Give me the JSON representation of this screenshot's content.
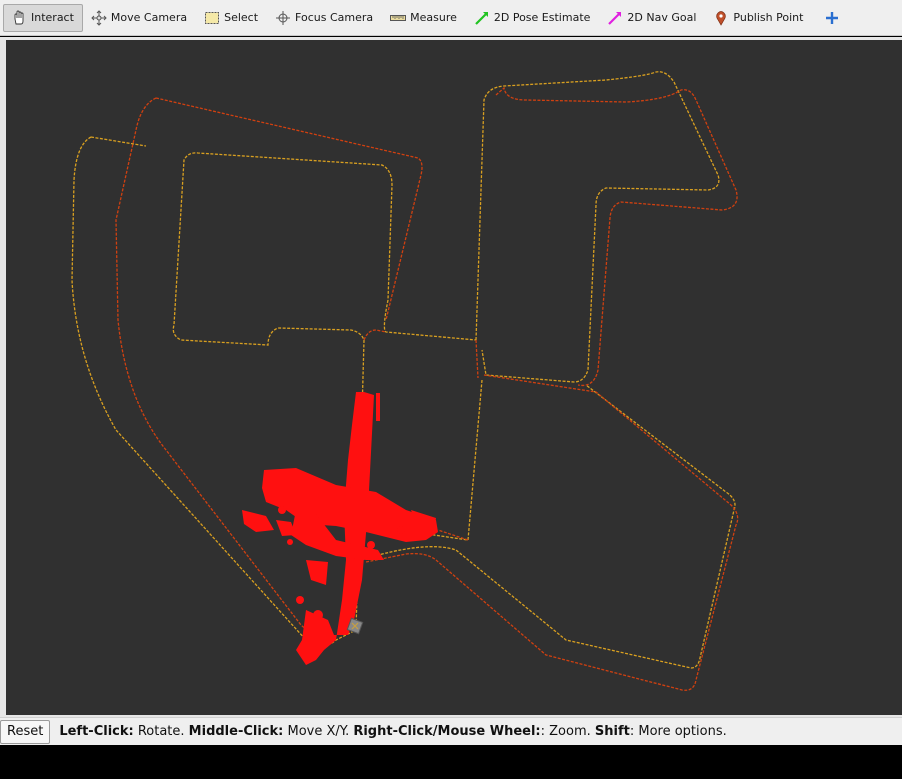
{
  "toolbar": {
    "tools": [
      {
        "label": "Interact",
        "icon": "hand-pointer-icon",
        "active": true
      },
      {
        "label": "Move Camera",
        "icon": "move-arrows-icon"
      },
      {
        "label": "Select",
        "icon": "select-box-icon"
      },
      {
        "label": "Focus Camera",
        "icon": "focus-target-icon"
      },
      {
        "label": "Measure",
        "icon": "ruler-icon"
      },
      {
        "label": "2D Pose Estimate",
        "icon": "green-arrow-icon",
        "color": "#22c322"
      },
      {
        "label": "2D Nav Goal",
        "icon": "magenta-arrow-icon",
        "color": "#e020e0"
      },
      {
        "label": "Publish Point",
        "icon": "map-pin-icon",
        "color": "#c0502a"
      }
    ],
    "more_icon": "plus-icon"
  },
  "viewport": {
    "background": "#303030",
    "trajectory_colors": [
      "#d9a020",
      "#d04010"
    ],
    "pointcloud_color": "#ff1010"
  },
  "statusbar": {
    "reset_label": "Reset",
    "hint": [
      {
        "bold": "Left-Click:",
        "text": " Rotate. "
      },
      {
        "bold": "Middle-Click:",
        "text": " Move X/Y. "
      },
      {
        "bold": "Right-Click/Mouse Wheel:",
        "text": ": Zoom. "
      },
      {
        "bold": "Shift",
        "text": ": More options."
      }
    ]
  }
}
